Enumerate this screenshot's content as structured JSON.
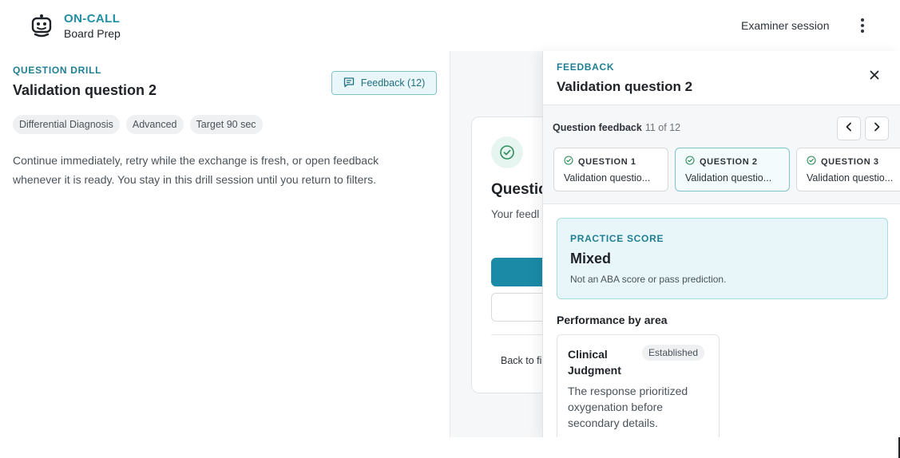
{
  "brand": {
    "title": "ON-CALL",
    "subtitle": "Board Prep",
    "logo_icon": "robot-face-icon"
  },
  "header": {
    "session_label": "Examiner session",
    "menu_icon": "kebab-menu-icon"
  },
  "drill": {
    "kicker": "QUESTION DRILL",
    "title": "Validation question 2",
    "feedback_button": "Feedback (12)",
    "tags": [
      "Differential Diagnosis",
      "Advanced",
      "Target 90 sec"
    ],
    "description": "Continue immediately, retry while the exchange is fresh, or open feedback whenever it is ready. You stay in this drill session until you return to filters."
  },
  "middle_card": {
    "heading": "Questic",
    "text": "Your feedl question.",
    "back_label": "Back to fi"
  },
  "feedback": {
    "kicker": "FEEDBACK",
    "title": "Validation question 2",
    "question_feedback_label": "Question feedback",
    "question_count": "11 of 12",
    "questions": [
      {
        "label": "QUESTION 1",
        "subtitle": "Validation questio..."
      },
      {
        "label": "QUESTION 2",
        "subtitle": "Validation questio..."
      },
      {
        "label": "QUESTION 3",
        "subtitle": "Validation questio..."
      }
    ],
    "practice_score": {
      "kicker": "PRACTICE SCORE",
      "value": "Mixed",
      "note": "Not an ABA score or pass prediction."
    },
    "performance_heading": "Performance by area",
    "areas": [
      {
        "name": "Clinical Judgment",
        "badge": "Established",
        "description": "The response prioritized oxygenation before secondary details."
      }
    ]
  },
  "colors": {
    "accent": "#1f7f92",
    "primary_button": "#1a8aa6",
    "success": "#2f8f5a"
  }
}
